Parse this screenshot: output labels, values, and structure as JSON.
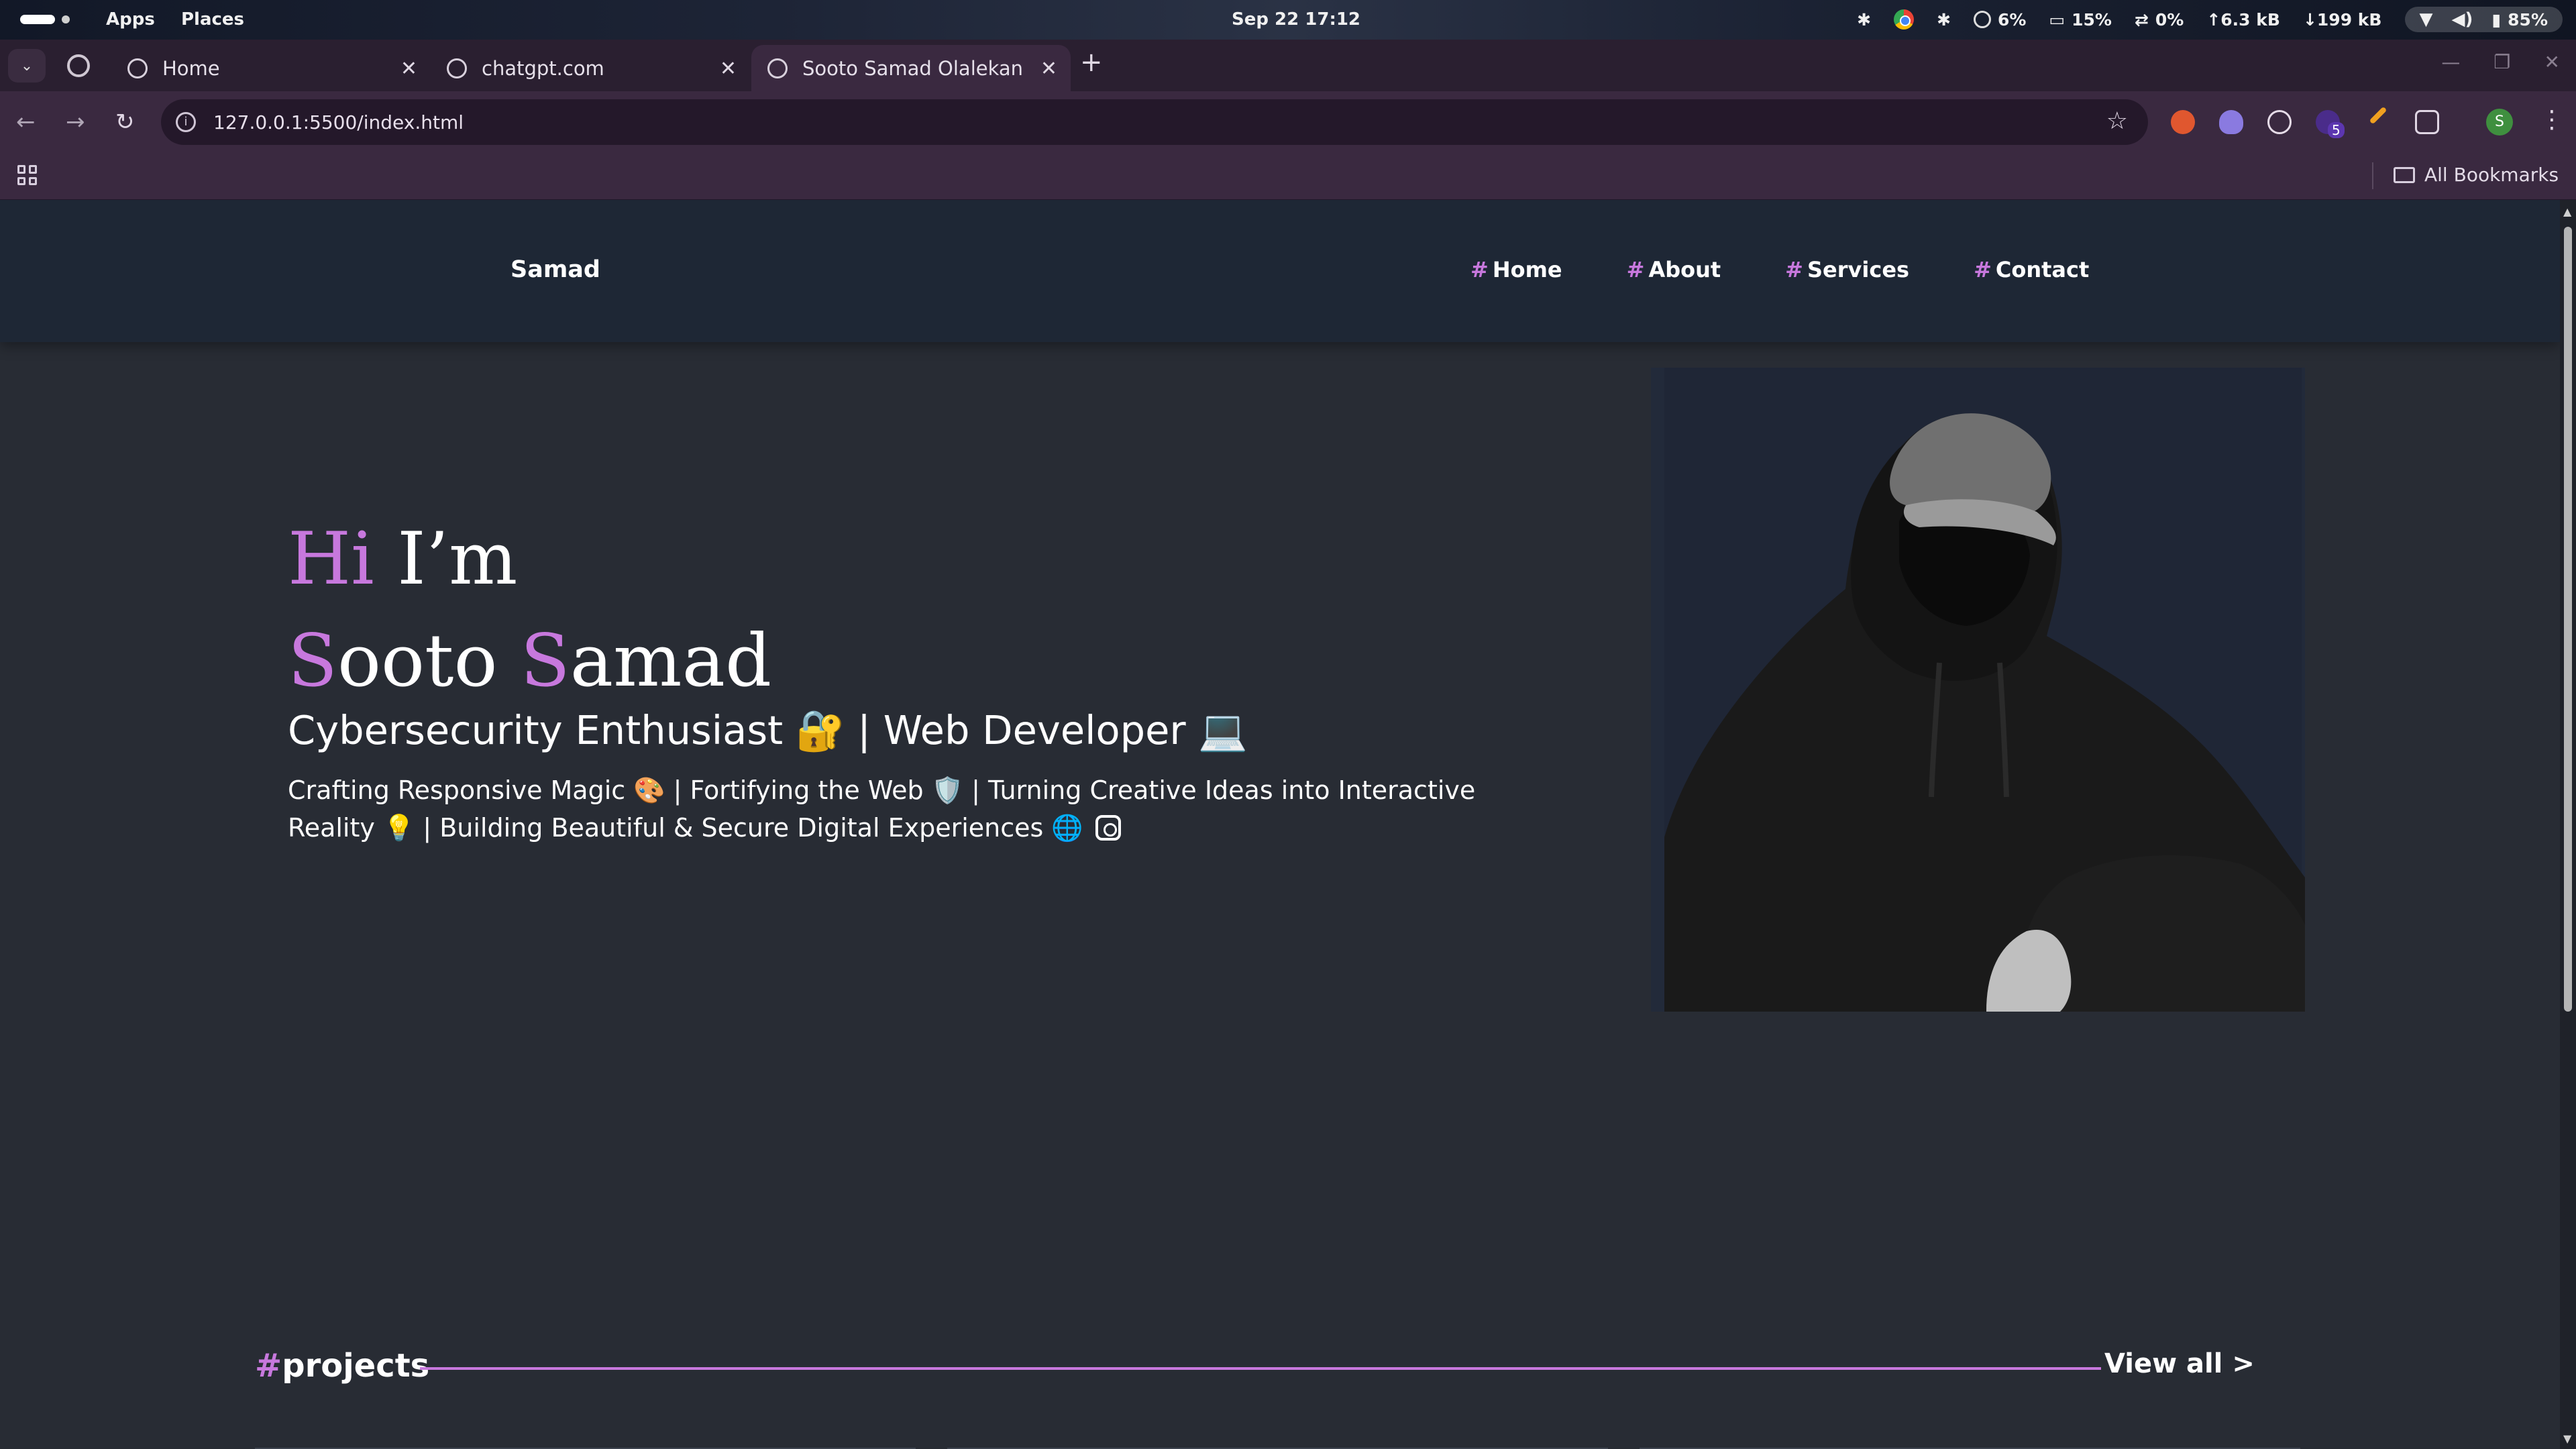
{
  "system_bar": {
    "apps": "Apps",
    "places": "Places",
    "datetime": "Sep 22  17:12",
    "cpu": "6%",
    "memory": "15%",
    "swap": "0%",
    "upload": "↑6.3 kB",
    "download": "↓199 kB",
    "battery": "85%"
  },
  "browser": {
    "tabs": [
      {
        "title": "Home"
      },
      {
        "title": "chatgpt.com"
      },
      {
        "title": "Sooto Samad Olalekan",
        "active": true
      }
    ],
    "url": "127.0.0.1:5500/index.html",
    "profile_initial": "S",
    "extension_badge": "5",
    "bookmarks_label": "All Bookmarks"
  },
  "site": {
    "logo": "Samad",
    "nav": [
      {
        "hash": "#",
        "label": "Home"
      },
      {
        "hash": "#",
        "label": "About"
      },
      {
        "hash": "#",
        "label": "Services"
      },
      {
        "hash": "#",
        "label": "Contact"
      }
    ],
    "hero": {
      "greeting_accent": "Hi",
      "greeting_rest": " I’m",
      "name_first_initial": "S",
      "name_first_rest": "ooto ",
      "name_last_initial": "S",
      "name_last_rest": "amad",
      "role": "Cybersecurity Enthusiast 🔐 | Web Developer 💻",
      "description": "Crafting Responsive Magic 🎨 | Fortifying the Web 🛡️ | Turning Creative Ideas into Interactive Reality 💡 | Building Beautiful & Secure Digital Experiences 🌐"
    },
    "projects": {
      "hash": "#",
      "title": "projects",
      "view_all": "View all  >"
    }
  },
  "colors": {
    "accent": "#c778dd",
    "page_bg": "#282c34",
    "nav_bg": "#1e2735"
  }
}
